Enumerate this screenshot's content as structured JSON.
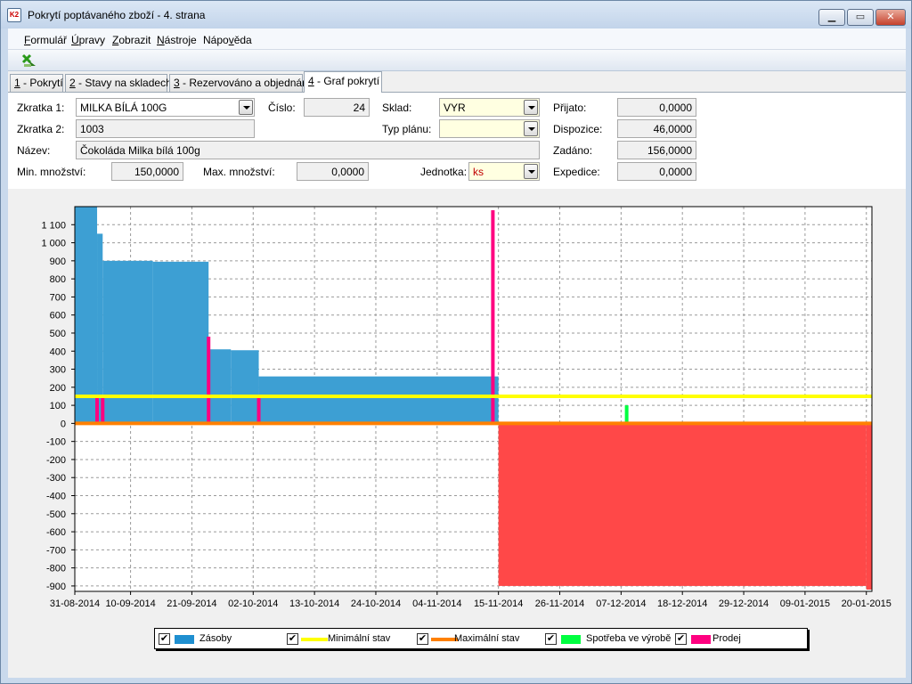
{
  "window": {
    "title": "Pokrytí poptávaného zboží - 4. strana",
    "app_icon_text": "K2"
  },
  "menu": [
    {
      "label": "Formulář",
      "mnemonic": "F",
      "rest": "ormulář"
    },
    {
      "label": "Úpravy",
      "mnemonic": "Ú",
      "rest": "pravy"
    },
    {
      "label": "Zobrazit",
      "mnemonic": "Z",
      "rest": "obrazit"
    },
    {
      "label": "Nástroje",
      "mnemonic": "N",
      "rest": "ástroje"
    },
    {
      "label": "Nápověda",
      "pre": "Nápo",
      "mnemonic": "v",
      "rest": "ěda"
    }
  ],
  "toolbar": {
    "icon": "exit-icon"
  },
  "tabs": [
    {
      "num": "1",
      "label": " - Pokrytí"
    },
    {
      "num": "2",
      "label": " - Stavy na skladech"
    },
    {
      "num": "3",
      "label": " - Rezervováno a objednáno"
    },
    {
      "num": "4",
      "label": " - Graf pokrytí",
      "active": true
    }
  ],
  "form": {
    "zkratka1_label": "Zkratka 1:",
    "zkratka1_value": "MILKA BÍLÁ 100G",
    "cislo_label": "Číslo:",
    "cislo_value": "24",
    "sklad_label": "Sklad:",
    "sklad_value": "VYR",
    "prijato_label": "Přijato:",
    "prijato_value": "0,0000",
    "zkratka2_label": "Zkratka 2:",
    "zkratka2_value": "1003",
    "typ_planu_label": "Typ plánu:",
    "typ_planu_value": "",
    "dispozice_label": "Dispozice:",
    "dispozice_value": "46,0000",
    "nazev_label": "Název:",
    "nazev_value": "Čokoláda Milka bílá 100g",
    "zadano_label": "Zadáno:",
    "zadano_value": "156,0000",
    "min_label": "Min. množství:",
    "min_value": "150,0000",
    "max_label": "Max. množství:",
    "max_value": "0,0000",
    "jednotka_label": "Jednotka:",
    "jednotka_value": "ks",
    "expedice_label": "Expedice:",
    "expedice_value": "0,0000"
  },
  "chart_data": {
    "type": "area",
    "grid": true,
    "x_tick_labels": [
      "31-08-2014",
      "10-09-2014",
      "21-09-2014",
      "02-10-2014",
      "13-10-2014",
      "24-10-2014",
      "04-11-2014",
      "15-11-2014",
      "26-11-2014",
      "07-12-2014",
      "18-12-2014",
      "29-12-2014",
      "09-01-2015",
      "20-01-2015"
    ],
    "y_tick_labels": [
      "1 100",
      "1 000",
      "900",
      "800",
      "700",
      "600",
      "500",
      "400",
      "300",
      "200",
      "100",
      "0",
      "-100",
      "-200",
      "-300",
      "-400",
      "-500",
      "-600",
      "-700",
      "-800",
      "-900"
    ],
    "ylim": [
      -930,
      1200
    ],
    "xlim": [
      "2014-08-31",
      "2015-01-21"
    ],
    "legend_position": "bottom",
    "series": [
      {
        "name": "Zásoby",
        "color": "#3d9fd3",
        "kind": "step-area",
        "points": [
          [
            "2014-08-31",
            1200
          ],
          [
            "2014-09-04",
            1050
          ],
          [
            "2014-09-05",
            900
          ],
          [
            "2014-09-14",
            895
          ],
          [
            "2014-09-24",
            410
          ],
          [
            "2014-09-28",
            405
          ],
          [
            "2014-10-03",
            260
          ],
          [
            "2014-11-14",
            260
          ],
          [
            "2014-11-15",
            -900
          ],
          [
            "2015-01-20",
            -920
          ]
        ]
      },
      {
        "name": "Minimální stav",
        "color": "#ffff00",
        "kind": "line",
        "value": 150
      },
      {
        "name": "Maximální stav",
        "color": "#ff8000",
        "kind": "line",
        "value": 0
      },
      {
        "name": "Spotřeba ve výrobě",
        "color": "#00ff40",
        "kind": "bars",
        "points": [
          [
            "2014-12-08",
            100
          ]
        ]
      },
      {
        "name": "Prodej",
        "color": "#ff0080",
        "kind": "bars",
        "points": [
          [
            "2014-09-04",
            150
          ],
          [
            "2014-09-05",
            150
          ],
          [
            "2014-09-24",
            480
          ],
          [
            "2014-10-03",
            150
          ],
          [
            "2014-11-14",
            1180
          ],
          [
            "2015-01-20",
            5
          ]
        ]
      }
    ]
  },
  "legend": [
    {
      "label": "Zásoby",
      "color": "#1f8fd0",
      "style": "box",
      "checked": "✔"
    },
    {
      "label": "Minimální stav",
      "color": "#ffff00",
      "style": "line",
      "checked": "✔"
    },
    {
      "label": "Maximální stav",
      "color": "#ff8000",
      "style": "line",
      "checked": "✔"
    },
    {
      "label": "Spotřeba ve výrobě",
      "color": "#00ff40",
      "style": "box",
      "checked": "✔"
    },
    {
      "label": "Prodej",
      "color": "#ff0080",
      "style": "box",
      "checked": "✔"
    }
  ]
}
